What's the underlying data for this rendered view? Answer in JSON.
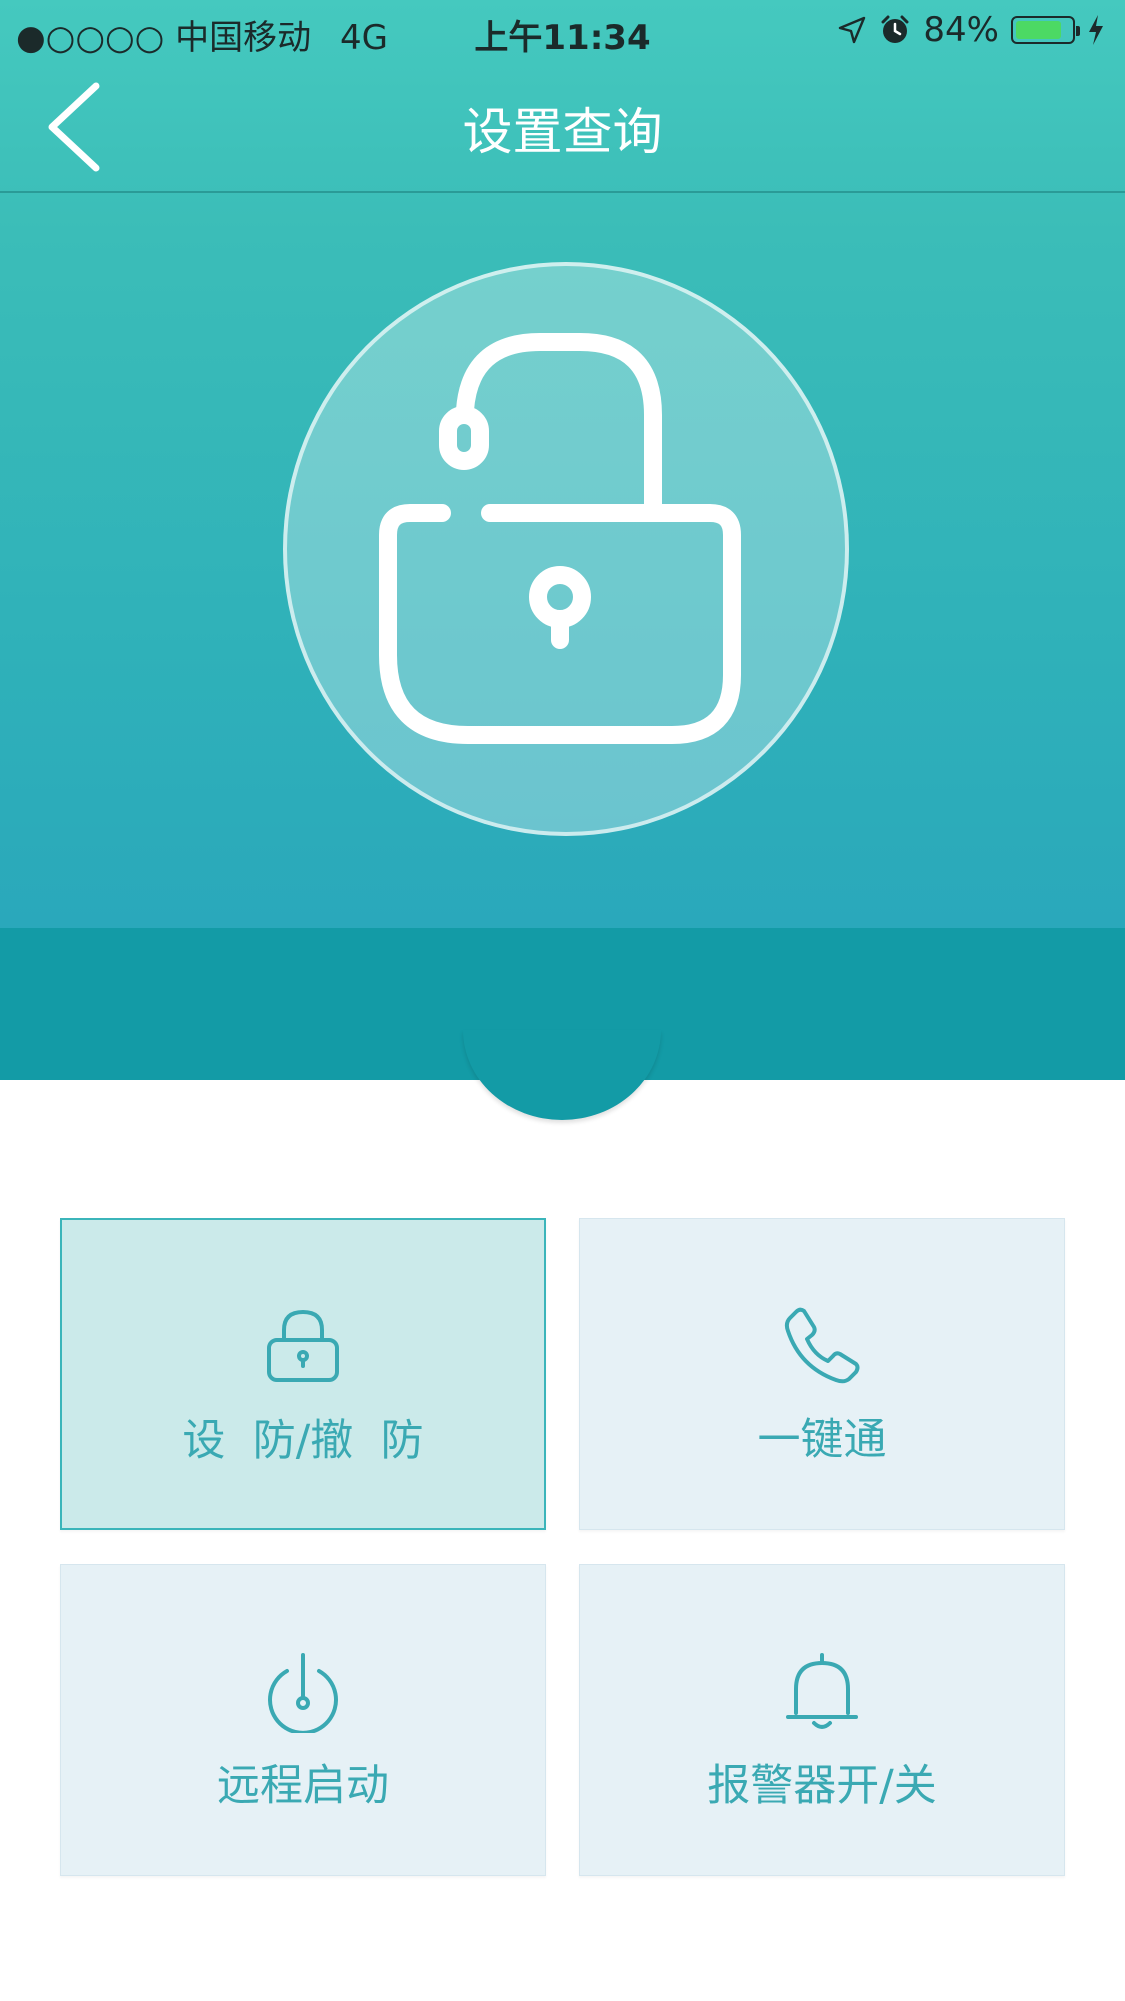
{
  "status_bar": {
    "carrier": "●○○○○ 中国移动",
    "network": "4G",
    "time": "上午11:34",
    "battery": "84%",
    "battery_level": 0.84,
    "icons": [
      "location-arrow-icon",
      "alarm-clock-icon",
      "battery-icon",
      "charging-bolt-icon"
    ]
  },
  "nav": {
    "title": "设置查询",
    "back_icon": "chevron-left-icon"
  },
  "hero": {
    "icon": "unlocked-padlock-icon"
  },
  "cards": [
    {
      "label": "设  防/撤  防",
      "icon": "padlock-icon",
      "active": true
    },
    {
      "label": "一键通",
      "icon": "phone-icon",
      "active": false
    },
    {
      "label": "远程启动",
      "icon": "power-icon",
      "active": false
    },
    {
      "label": "报警器开/关",
      "icon": "bell-icon",
      "active": false
    }
  ],
  "colors": {
    "header_teal": "#45c9bf",
    "band_teal": "#139ba6",
    "card_bg": "#e6f1f6",
    "card_active_bg": "#cbeaea",
    "accent": "#3aa9b3"
  }
}
